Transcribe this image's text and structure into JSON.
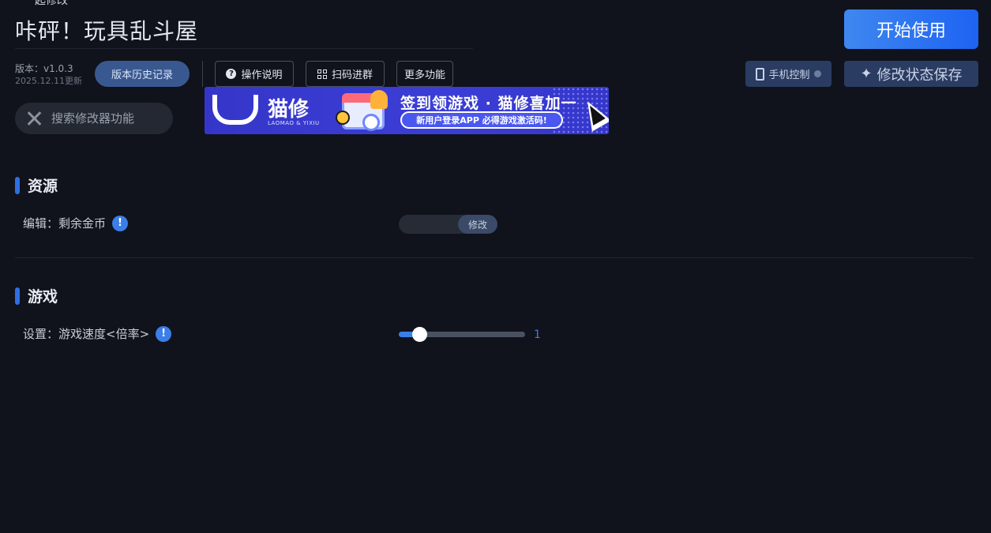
{
  "header": {
    "top_cut_text": "一起修改",
    "game_title": "咔砰！玩具乱斗屋",
    "start_button": "开始使用"
  },
  "version": {
    "label": "版本：v1.0.3",
    "updated": "2025.12.11更新"
  },
  "toolbar": {
    "history_button": "版本历史记录",
    "help_button": "操作说明",
    "qr_button": "扫码进群",
    "more_button": "更多功能",
    "phone_button": "手机控制",
    "save_button": "修改状态保存"
  },
  "search": {
    "placeholder": "搜索修改器功能"
  },
  "banner": {
    "brand_cn": "猫修",
    "brand_en": "LAOMAO & YIXIU",
    "headline": "签到领游戏 · 猫修喜加一",
    "pill": "新用户登录APP  必得游戏激活码!"
  },
  "sections": [
    {
      "title": "资源",
      "rows": [
        {
          "label": "编辑：剩余金币",
          "info": "!",
          "action": "修改",
          "value": ""
        }
      ]
    },
    {
      "title": "游戏",
      "rows": [
        {
          "label": "设置：游戏速度<倍率>",
          "info": "!",
          "slider_value": "1",
          "slider_fraction": 0.16
        }
      ]
    }
  ],
  "colors": {
    "accent": "#3a7ee8",
    "background": "#10131b",
    "button_dark": "#2b3c62"
  }
}
